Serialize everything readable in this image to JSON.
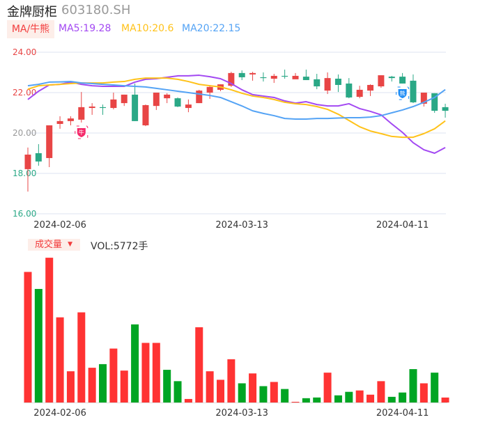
{
  "header": {
    "name": "金牌厨柜",
    "code": "603180.SH"
  },
  "ma_legend": {
    "tag": "MA/牛熊",
    "ma5": "MA5:19.28",
    "ma10": "MA10:20.6",
    "ma20": "MA20:22.15"
  },
  "volume_legend": {
    "tag": "成交量",
    "dropdown_icon": "caret-down-icon",
    "value": "VOL:5772手"
  },
  "colors": {
    "up": "#e84545",
    "down": "#2aa886",
    "vol_up": "#ff3333",
    "vol_down": "#00a523",
    "ma5": "#a349f2",
    "ma10": "#ffc21a",
    "ma20": "#54a3f5"
  },
  "markers": [
    {
      "label": "牛",
      "index": 5,
      "color": "#f5296a"
    },
    {
      "label": "熊",
      "index": 35,
      "color": "#1d8cf5"
    }
  ],
  "chart_data": [
    {
      "type": "candlestick",
      "title": "金牌厨柜 603180.SH",
      "ylim": [
        16,
        24
      ],
      "y_ticks": [
        "24.00",
        "22.00",
        "20.00",
        "18.00",
        "16.00"
      ],
      "y_tick_values": [
        24,
        22,
        20,
        18,
        16
      ],
      "x_tick_labels": [
        {
          "index": 3,
          "label": "2024-02-06"
        },
        {
          "index": 20,
          "label": "2024-03-13"
        },
        {
          "index": 35,
          "label": "2024-04-11"
        }
      ],
      "grid": true,
      "ohlc": [
        [
          18.21,
          19.28,
          17.1,
          18.93
        ],
        [
          19.0,
          19.45,
          18.38,
          18.59
        ],
        [
          18.76,
          20.38,
          18.31,
          20.38
        ],
        [
          20.45,
          20.83,
          20.21,
          20.59
        ],
        [
          20.59,
          20.83,
          20.38,
          20.72
        ],
        [
          20.66,
          22.03,
          20.52,
          21.28
        ],
        [
          21.24,
          21.48,
          20.9,
          21.31
        ],
        [
          21.28,
          21.41,
          20.9,
          21.24
        ],
        [
          21.24,
          22.0,
          21.17,
          21.66
        ],
        [
          21.48,
          21.9,
          21.34,
          21.9
        ],
        [
          21.9,
          22.45,
          20.59,
          20.59
        ],
        [
          20.38,
          21.41,
          20.34,
          21.38
        ],
        [
          21.34,
          22.0,
          21.14,
          22.0
        ],
        [
          21.72,
          21.97,
          21.48,
          21.9
        ],
        [
          21.72,
          21.76,
          21.28,
          21.31
        ],
        [
          21.24,
          21.66,
          21.03,
          21.41
        ],
        [
          21.48,
          22.14,
          21.48,
          22.1
        ],
        [
          22.0,
          22.38,
          21.69,
          22.28
        ],
        [
          22.14,
          22.41,
          22.07,
          22.41
        ],
        [
          22.34,
          23.03,
          22.28,
          22.97
        ],
        [
          22.97,
          23.1,
          22.62,
          22.76
        ],
        [
          22.9,
          23.03,
          22.59,
          22.97
        ],
        [
          22.76,
          23.0,
          22.55,
          22.72
        ],
        [
          22.69,
          22.93,
          22.48,
          22.83
        ],
        [
          22.83,
          23.14,
          22.69,
          22.79
        ],
        [
          22.66,
          22.97,
          22.69,
          22.83
        ],
        [
          22.79,
          23.14,
          22.62,
          22.62
        ],
        [
          22.66,
          22.93,
          22.17,
          22.31
        ],
        [
          22.1,
          23.0,
          21.93,
          22.72
        ],
        [
          22.69,
          22.9,
          22.03,
          22.38
        ],
        [
          22.45,
          22.72,
          21.72,
          21.76
        ],
        [
          21.79,
          22.34,
          21.72,
          22.14
        ],
        [
          22.1,
          22.41,
          21.83,
          22.38
        ],
        [
          22.31,
          22.86,
          22.24,
          22.86
        ],
        [
          22.79,
          22.83,
          22.55,
          22.72
        ],
        [
          22.79,
          22.97,
          22.45,
          22.45
        ],
        [
          22.59,
          22.9,
          21.48,
          21.52
        ],
        [
          21.45,
          22.0,
          21.31,
          22.0
        ],
        [
          21.97,
          21.97,
          21.0,
          21.1
        ],
        [
          21.28,
          21.45,
          20.76,
          21.1
        ]
      ],
      "series": [
        {
          "name": "MA5",
          "values": [
            21.66,
            22.07,
            22.38,
            22.41,
            22.52,
            22.41,
            22.34,
            22.31,
            22.31,
            22.31,
            22.52,
            22.66,
            22.69,
            22.76,
            22.83,
            22.83,
            22.86,
            22.79,
            22.69,
            22.45,
            22.14,
            21.9,
            21.83,
            21.76,
            21.59,
            21.48,
            21.55,
            21.41,
            21.34,
            21.34,
            21.45,
            21.21,
            21.07,
            20.9,
            20.45,
            20.03,
            19.52,
            19.17,
            19.0,
            19.28
          ]
        },
        {
          "name": "MA10",
          "values": [
            22.17,
            22.34,
            22.38,
            22.41,
            22.45,
            22.48,
            22.48,
            22.48,
            22.52,
            22.55,
            22.66,
            22.72,
            22.72,
            22.72,
            22.66,
            22.55,
            22.41,
            22.34,
            22.28,
            22.14,
            21.97,
            21.83,
            21.76,
            21.66,
            21.52,
            21.45,
            21.41,
            21.31,
            21.17,
            20.93,
            20.62,
            20.31,
            20.1,
            19.97,
            19.83,
            19.79,
            19.79,
            19.97,
            20.21,
            20.6
          ]
        },
        {
          "name": "MA20",
          "values": [
            22.34,
            22.41,
            22.52,
            22.53,
            22.55,
            22.48,
            22.45,
            22.41,
            22.38,
            22.34,
            22.31,
            22.28,
            22.21,
            22.14,
            22.07,
            22.0,
            21.93,
            21.86,
            21.76,
            21.55,
            21.34,
            21.1,
            20.97,
            20.86,
            20.72,
            20.69,
            20.69,
            20.72,
            20.72,
            20.74,
            20.76,
            20.76,
            20.79,
            20.86,
            21.0,
            21.14,
            21.31,
            21.52,
            21.76,
            22.15
          ]
        }
      ]
    },
    {
      "type": "bar",
      "title": "成交量",
      "ylabel": "手",
      "ylim": [
        0,
        170000
      ],
      "x_tick_labels": [
        {
          "index": 3,
          "label": "2024-02-06"
        },
        {
          "index": 20,
          "label": "2024-03-13"
        },
        {
          "index": 35,
          "label": "2024-04-11"
        }
      ],
      "values": [
        151800,
        132000,
        168300,
        99000,
        36300,
        104800,
        40400,
        44600,
        62700,
        37100,
        90800,
        69300,
        69300,
        38000,
        24800,
        4100,
        87500,
        36300,
        26400,
        50300,
        22300,
        33800,
        19000,
        23900,
        15700,
        800,
        5000,
        5800,
        34700,
        8300,
        12400,
        14000,
        9100,
        24800,
        6600,
        11600,
        38800,
        22300,
        34700,
        5772
      ],
      "direction": [
        "up",
        "down",
        "up",
        "up",
        "up",
        "up",
        "up",
        "down",
        "up",
        "up",
        "down",
        "up",
        "up",
        "down",
        "down",
        "up",
        "up",
        "up",
        "up",
        "up",
        "down",
        "up",
        "down",
        "up",
        "down",
        "up",
        "down",
        "down",
        "up",
        "down",
        "down",
        "up",
        "up",
        "up",
        "down",
        "down",
        "down",
        "up",
        "down",
        "up"
      ]
    }
  ]
}
